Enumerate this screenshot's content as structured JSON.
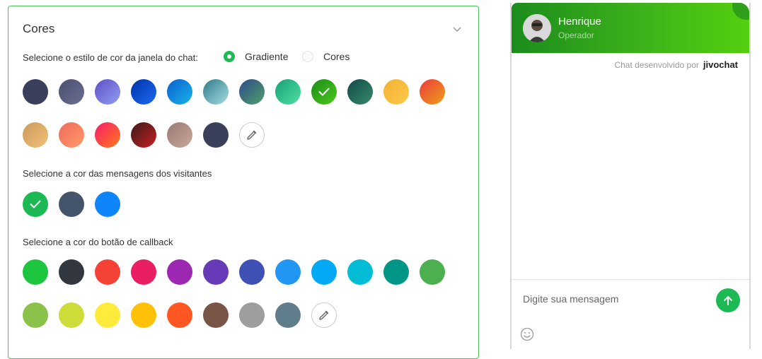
{
  "colors_panel": {
    "title": "Cores",
    "style_label": "Selecione o estilo de cor da janela do chat:",
    "style_options": [
      {
        "label": "Gradiente",
        "selected": true
      },
      {
        "label": "Cores",
        "selected": false
      }
    ],
    "gradient_swatches_row1": [
      {
        "c1": "#3a3f5c",
        "c2": "#3a3f5c"
      },
      {
        "c1": "#4a4f72",
        "c2": "#6a6f92"
      },
      {
        "c1": "#5f4fc8",
        "c2": "#8e9ef0"
      },
      {
        "c1": "#0033aa",
        "c2": "#1c6af0"
      },
      {
        "c1": "#0a5fd0",
        "c2": "#1ab4e8"
      },
      {
        "c1": "#2e7a88",
        "c2": "#a8dde4"
      },
      {
        "c1": "#2f4a8a",
        "c2": "#4fa06a"
      },
      {
        "c1": "#1aa07a",
        "c2": "#4de0a0"
      },
      {
        "c1": "#1c8c1c",
        "c2": "#4cc81a",
        "selected": true
      },
      {
        "c1": "#0f4a4a",
        "c2": "#3a8a6a"
      },
      {
        "c1": "#f2b233",
        "c2": "#ffc84a"
      },
      {
        "c1": "#e83a3a",
        "c2": "#f2a01a"
      }
    ],
    "gradient_swatches_row2": [
      {
        "c1": "#c99a5a",
        "c2": "#f2c27a"
      },
      {
        "c1": "#f06a5a",
        "c2": "#ff9a6a"
      },
      {
        "c1": "#f51a6a",
        "c2": "#ff7a1a"
      },
      {
        "c1": "#3a1a1a",
        "c2": "#c82020"
      },
      {
        "c1": "#9a7a72",
        "c2": "#c8a89a"
      },
      {
        "c1": "#3a3f5c",
        "c2": "#3a3f5c"
      }
    ],
    "visitor_label": "Selecione a cor das mensagens dos visitantes",
    "visitor_swatches": [
      {
        "color": "#1db954",
        "selected": true
      },
      {
        "color": "#44546a",
        "selected": false
      },
      {
        "color": "#0e85f8",
        "selected": false
      }
    ],
    "callback_label": "Selecione a cor do botão de callback",
    "callback_row1": [
      "#1ec63f",
      "#33373f",
      "#f44336",
      "#e91e63",
      "#9c27b0",
      "#673ab7",
      "#3f51b5",
      "#2196f3",
      "#03a9f4",
      "#00bcd4",
      "#009688",
      "#4caf50"
    ],
    "callback_row2": [
      "#8bc34a",
      "#cddc39",
      "#ffeb3b",
      "#ffc107",
      "#ff5722",
      "#795548",
      "#9e9e9e",
      "#607d8b"
    ]
  },
  "chat_preview": {
    "operator_name": "Henrique",
    "operator_role": "Operador",
    "powered_by": "Chat desenvolvido por",
    "brand": "jivochat",
    "input_placeholder": "Digite sua mensagem"
  }
}
